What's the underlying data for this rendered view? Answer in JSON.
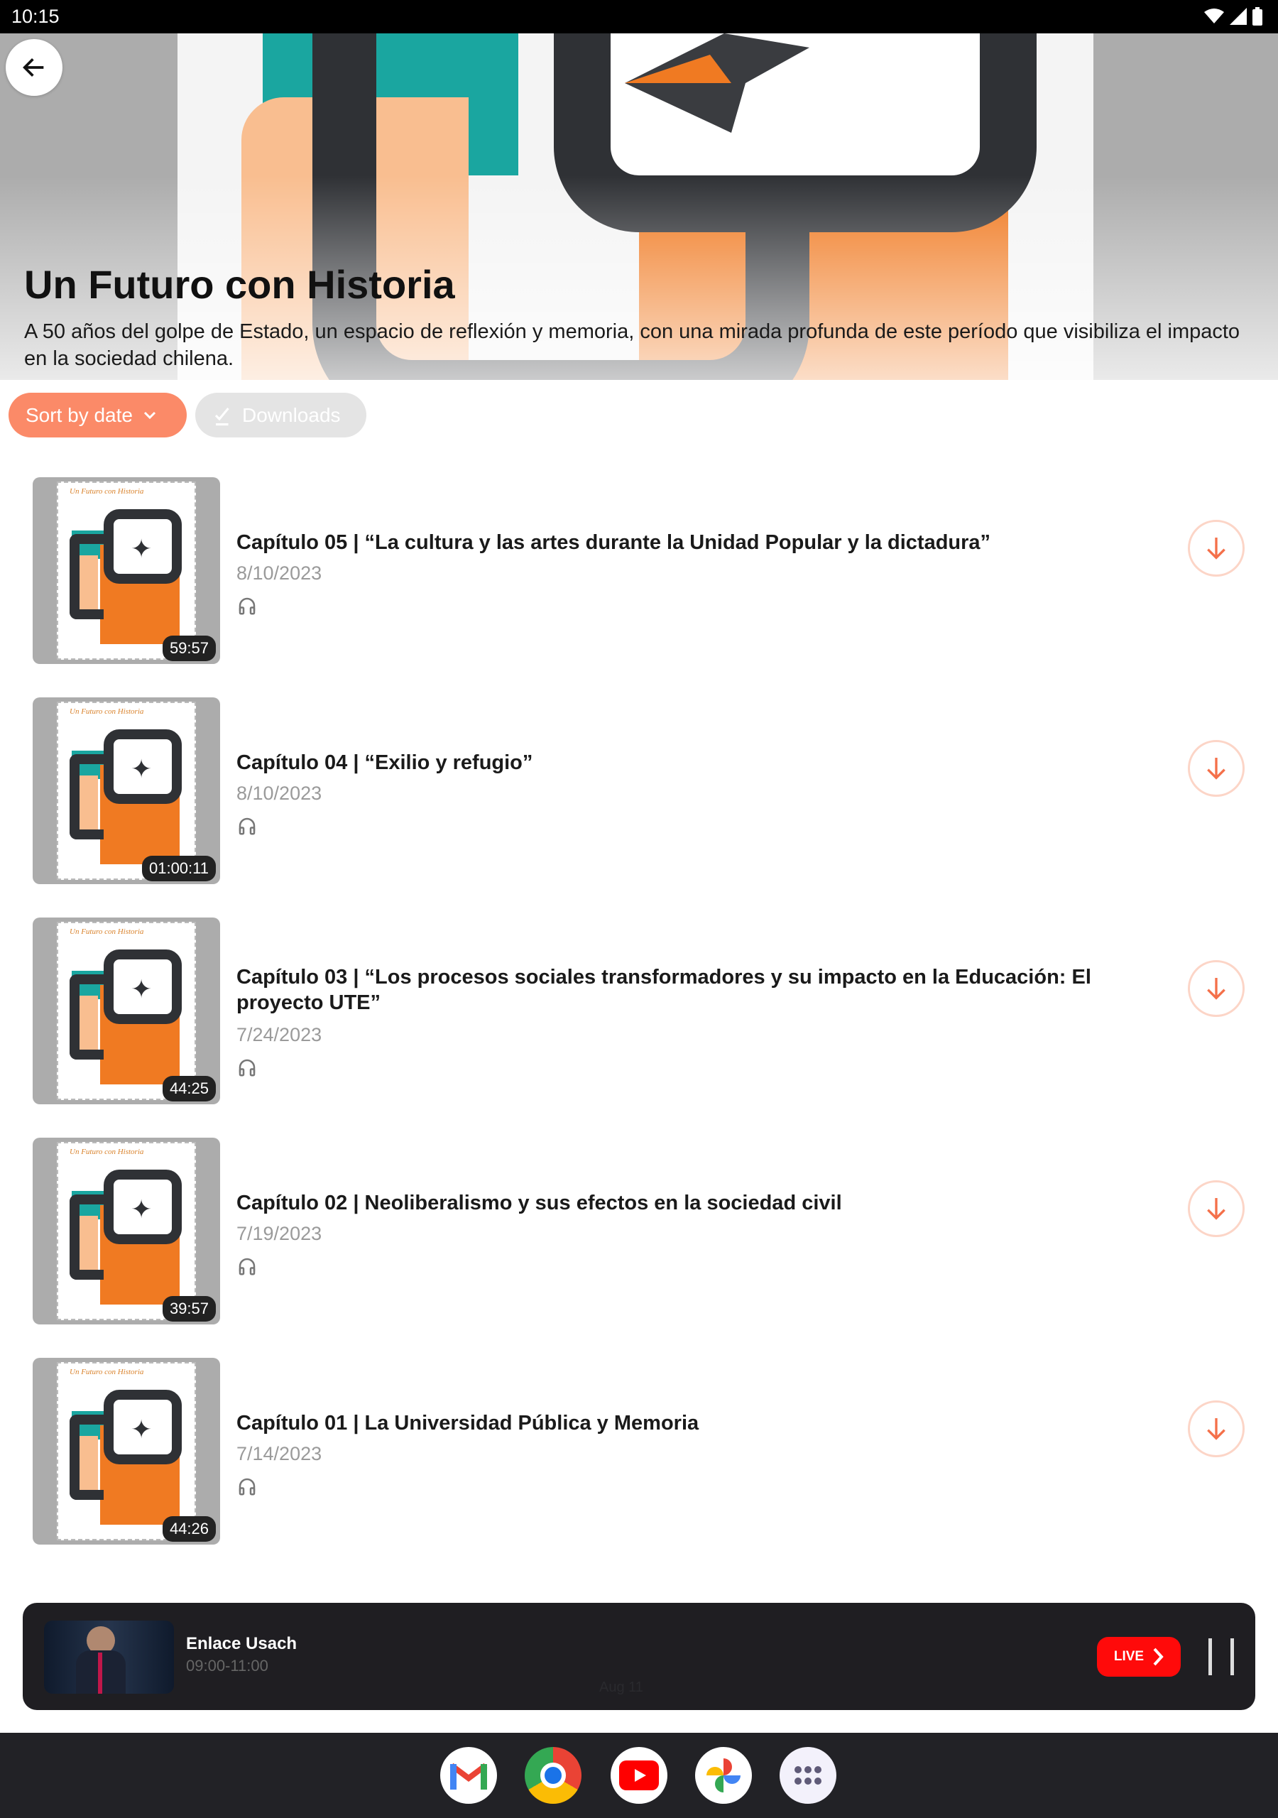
{
  "status_bar": {
    "time": "10:15",
    "icons": [
      "wifi-icon",
      "signal-icon",
      "battery-icon"
    ]
  },
  "header": {
    "back_icon": "arrow-left-icon",
    "title": "Un Futuro con Historia",
    "description": "A 50 años del golpe de Estado, un espacio de reflexión y memoria, con una mirada profunda de este período que visibiliza el impacto en la sociedad chilena."
  },
  "filters": {
    "sort_label": "Sort by date",
    "downloads_label": "Downloads"
  },
  "colors": {
    "accent": "#fb8a68",
    "live": "#ff0a0a",
    "player_bg": "#1f1e22"
  },
  "episodes": [
    {
      "title": "Capítulo 05 | “La cultura y las artes durante la Unidad Popular y la dictadura”",
      "date": "8/10/2023",
      "duration": "59:57"
    },
    {
      "title": "Capítulo 04 | “Exilio y refugio”",
      "date": "8/10/2023",
      "duration": "01:00:11"
    },
    {
      "title": "Capítulo 03 | “Los procesos sociales transformadores y su impacto en la Educación: El proyecto UTE”",
      "date": "7/24/2023",
      "duration": "44:25"
    },
    {
      "title": "Capítulo 02 | Neoliberalismo y sus efectos en la sociedad civil",
      "date": "7/19/2023",
      "duration": "39:57"
    },
    {
      "title": "Capítulo 01 | La Universidad Pública y Memoria",
      "date": "7/14/2023",
      "duration": "44:26"
    }
  ],
  "player": {
    "title": "Enlace Usach",
    "time": "09:00-11:00",
    "faint_date": "Aug 11",
    "live_label": "LIVE"
  },
  "nav_apps": [
    "Gmail",
    "Chrome",
    "YouTube",
    "Photos",
    "App drawer"
  ]
}
